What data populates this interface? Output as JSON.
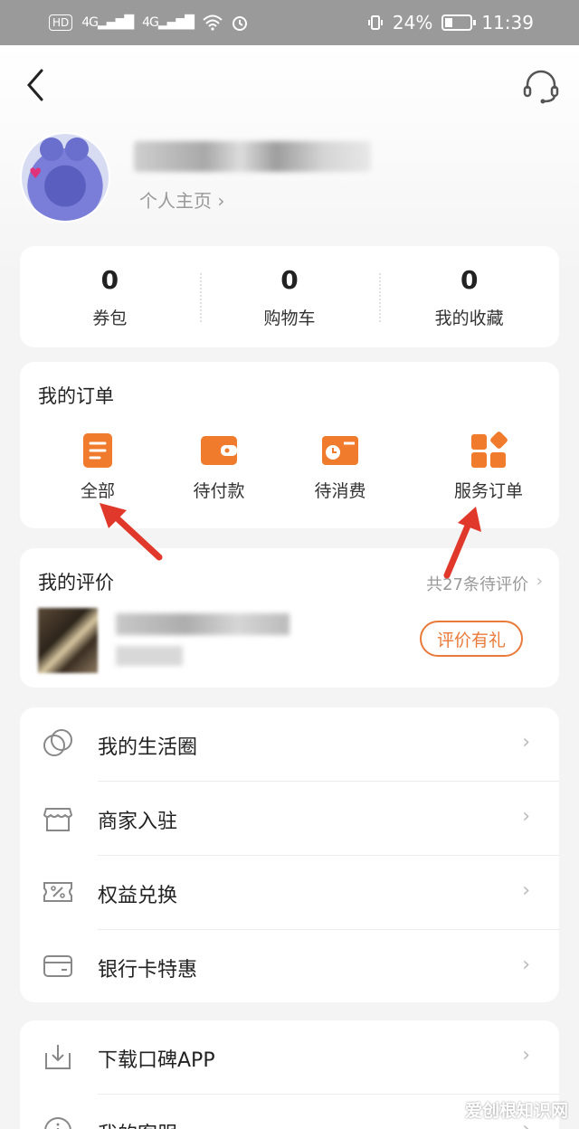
{
  "status_bar": {
    "hd": "HD",
    "sim1": "4G",
    "sim2": "4G",
    "battery_text": "24%",
    "time": "11:39"
  },
  "header": {
    "back_icon": "chevron-left-icon",
    "service_icon": "headset-icon",
    "profile_link": "个人主页 ›"
  },
  "stats": [
    {
      "value": "0",
      "label": "券包"
    },
    {
      "value": "0",
      "label": "购物车"
    },
    {
      "value": "0",
      "label": "我的收藏"
    }
  ],
  "orders": {
    "title": "我的订单",
    "items": [
      {
        "label": "全部",
        "icon": "document-icon"
      },
      {
        "label": "待付款",
        "icon": "wallet-icon"
      },
      {
        "label": "待消费",
        "icon": "ticket-clock-icon"
      },
      {
        "label": "服务订单",
        "icon": "grid-diamond-icon"
      }
    ]
  },
  "reviews": {
    "title": "我的评价",
    "pending": "共27条待评价",
    "button": "评价有礼"
  },
  "menu": [
    {
      "label": "我的生活圈",
      "icon": "circles-icon"
    },
    {
      "label": "商家入驻",
      "icon": "store-icon"
    },
    {
      "label": "权益兑换",
      "icon": "coupon-percent-icon"
    },
    {
      "label": "银行卡特惠",
      "icon": "card-icon"
    }
  ],
  "menu2": [
    {
      "label": "下载口碑APP",
      "icon": "download-icon"
    },
    {
      "label": "我的客服",
      "icon": "info-icon"
    }
  ],
  "watermark": "爱创根知识网",
  "colors": {
    "accent": "#f07b2c",
    "status_bar": "#9a9a9a",
    "arrow": "#e0392b"
  }
}
